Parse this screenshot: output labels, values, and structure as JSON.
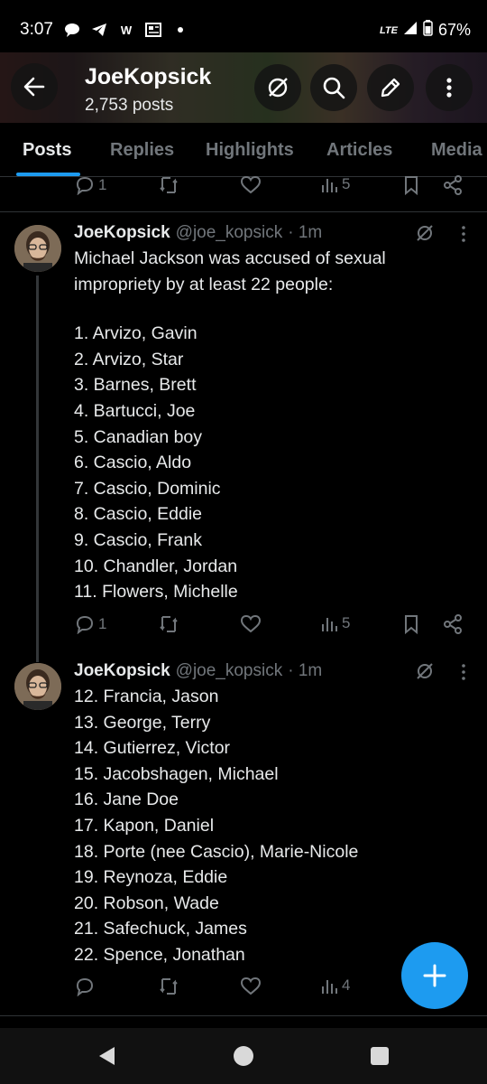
{
  "status_bar": {
    "time": "3:07",
    "network": "LTE",
    "battery": "67%"
  },
  "header": {
    "name": "JoeKopsick",
    "post_count": "2,753 posts"
  },
  "tabs": [
    {
      "label": "Posts",
      "active": true
    },
    {
      "label": "Replies",
      "active": false
    },
    {
      "label": "Highlights",
      "active": false
    },
    {
      "label": "Articles",
      "active": false
    },
    {
      "label": "Media",
      "active": false
    }
  ],
  "previous_post_actions": {
    "replies": "1",
    "views": "5"
  },
  "posts": [
    {
      "author": "JoeKopsick",
      "handle": "@joe_kopsick",
      "time": "· 1m",
      "intro": [
        "Michael Jackson was accused of sexual",
        "impropriety by at least 22 people:"
      ],
      "lines": [
        "1. Arvizo, Gavin",
        "2. Arvizo, Star",
        "3. Barnes, Brett",
        "4. Bartucci, Joe",
        "5. Canadian boy",
        "6. Cascio, Aldo",
        "7. Cascio, Dominic",
        "8. Cascio, Eddie",
        "9. Cascio, Frank",
        "10. Chandler, Jordan",
        "11. Flowers, Michelle"
      ],
      "replies": "1",
      "views": "5"
    },
    {
      "author": "JoeKopsick",
      "handle": "@joe_kopsick",
      "time": "· 1m",
      "lines": [
        "12. Francia, Jason",
        "13. George, Terry",
        "14. Gutierrez, Victor",
        "15. Jacobshagen, Michael",
        "16. Jane Doe",
        "17. Kapon, Daniel",
        "18. Porte (nee Cascio), Marie-Nicole",
        "19. Reynoza, Eddie",
        "20. Robson, Wade",
        "21. Safechuck, James",
        "22. Spence, Jonathan"
      ],
      "replies": "",
      "views": "4"
    }
  ],
  "colors": {
    "accent": "#1d9bf0",
    "muted": "#71767b",
    "text": "#e7e9ea",
    "background": "#000000"
  }
}
